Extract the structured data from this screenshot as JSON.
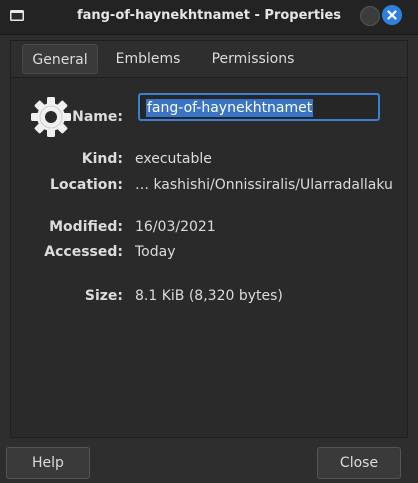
{
  "window": {
    "title": "fang-of-haynekhtnamet - Properties",
    "icon": "folder-icon",
    "accent": "#2f7fdd"
  },
  "tabs": [
    {
      "label": "General",
      "active": true
    },
    {
      "label": "Emblems",
      "active": false
    },
    {
      "label": "Permissions",
      "active": false
    }
  ],
  "general": {
    "file_icon": "gear-icon",
    "name_label": "Name:",
    "name_value": "fang-of-haynekhtnamet",
    "kind_label": "Kind:",
    "kind_value": "executable",
    "location_label": "Location:",
    "location_value": "… kashishi/Onnissiralis/Ularradallaku",
    "modified_label": "Modified:",
    "modified_value": "16/03/2021",
    "accessed_label": "Accessed:",
    "accessed_value": "Today",
    "size_label": "Size:",
    "size_value": "8.1 KiB (8,320 bytes)"
  },
  "buttons": {
    "help": "Help",
    "close": "Close"
  }
}
